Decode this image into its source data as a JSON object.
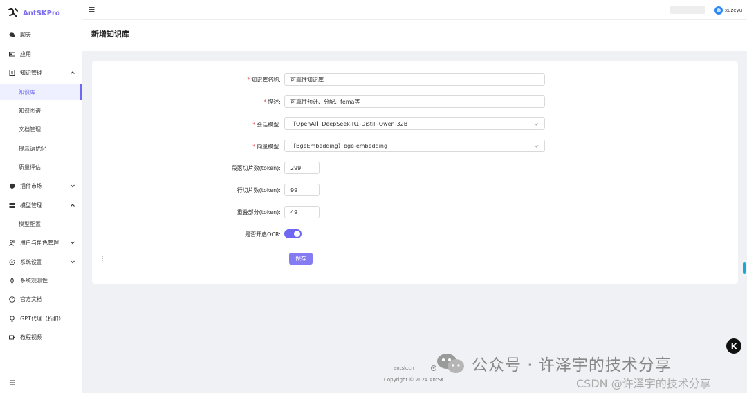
{
  "app": {
    "name": "AntSKPro"
  },
  "header": {
    "username": "xuzeyu"
  },
  "page": {
    "title": "新增知识库"
  },
  "sidebar": {
    "items": [
      {
        "label": "聊天",
        "icon": "chat-icon"
      },
      {
        "label": "应用",
        "icon": "app-icon"
      },
      {
        "label": "知识管理",
        "icon": "book-icon",
        "expanded": true
      },
      {
        "label": "插件市场",
        "icon": "plugin-icon"
      },
      {
        "label": "模型管理",
        "icon": "model-icon",
        "expanded": true
      },
      {
        "label": "用户与角色管理",
        "icon": "users-icon"
      },
      {
        "label": "系统设置",
        "icon": "gear-icon"
      },
      {
        "label": "系统观测性",
        "icon": "eye-icon"
      },
      {
        "label": "官方文档",
        "icon": "question-icon"
      },
      {
        "label": "GPT代理（折扣）",
        "icon": "bulb-icon"
      },
      {
        "label": "教程视频",
        "icon": "video-icon"
      }
    ],
    "knowledge_sub": [
      "知识库",
      "知识图谱",
      "文档管理",
      "提示语优化",
      "质量评估"
    ],
    "model_sub": [
      "模型配置"
    ]
  },
  "form": {
    "name_label": "知识库名称:",
    "name_value": "可靠性知识库",
    "desc_label": "描述:",
    "desc_value": "可靠性预计、分配、fema等",
    "chat_model_label": "会话模型:",
    "chat_model_value": "【OpenAI】DeepSeek-R1-Distill-Qwen-32B",
    "embed_model_label": "向量模型:",
    "embed_model_value": "【BgeEmbedding】bge-embedding",
    "para_chunk_label": "段落切片数(token):",
    "para_chunk_value": "299",
    "line_chunk_label": "行切片数(token):",
    "line_chunk_value": "99",
    "overlap_label": "重叠部分(token):",
    "overlap_value": "49",
    "ocr_label": "是否开启OCR:",
    "ocr_enabled": true,
    "save_label": "保存"
  },
  "footer": {
    "link": "antsk.cn",
    "copyright": "Copyright © 2024 AntSK"
  },
  "watermark": {
    "main": "公众号 · 许泽宇的技术分享",
    "csdn": "CSDN @许泽宇的技术分享",
    "badge": "K"
  },
  "colors": {
    "accent": "#6e68f2",
    "button": "#857cf4",
    "required": "#e84c4c"
  }
}
